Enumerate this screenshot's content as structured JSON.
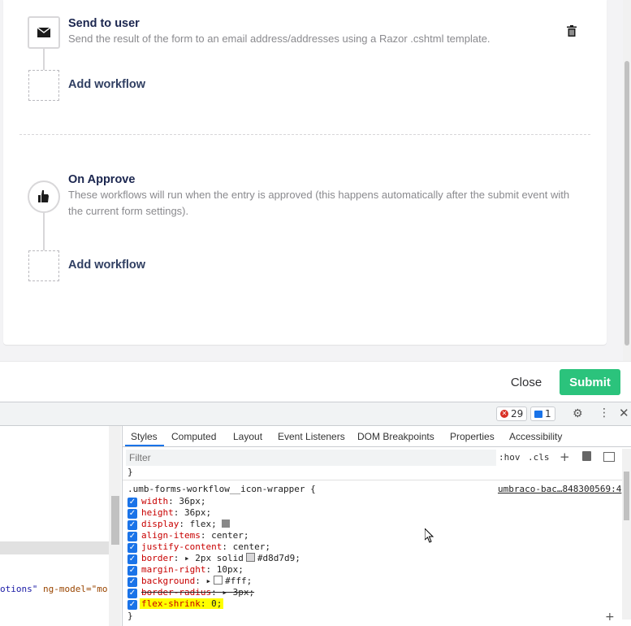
{
  "workflows": {
    "send_to_user": {
      "title": "Send to user",
      "description": "Send the result of the form to an email address/addresses using a Razor .cshtml template."
    },
    "add_workflow_1": "Add workflow",
    "on_approve": {
      "title": "On Approve",
      "description_line1": "These workflows will run when the entry is approved (this happens automatically after the submit event with",
      "description_line2": "the current form settings)."
    },
    "add_workflow_2": "Add workflow"
  },
  "footer": {
    "close_label": "Close",
    "submit_label": "Submit"
  },
  "devtools": {
    "error_count": "29",
    "message_count": "1",
    "tabs": [
      "Styles",
      "Computed",
      "Layout",
      "Event Listeners",
      "DOM Breakpoints",
      "Properties",
      "Accessibility"
    ],
    "filter_placeholder": "Filter",
    "hov": ":hov",
    "cls": ".cls",
    "left_code_frag1": "otions\"",
    "left_code_frag2": "ng-model=\"mo",
    "prev_rule_close": "}",
    "selector": ".umb-forms-workflow__icon-wrapper {",
    "source_link": "umbraco-bac…848300569:4",
    "rules": {
      "width": {
        "name": "width",
        "value": "36px;"
      },
      "height": {
        "name": "height",
        "value": "36px;"
      },
      "display": {
        "name": "display",
        "value": "flex;"
      },
      "align_items": {
        "name": "align-items",
        "value": "center;"
      },
      "justify_content": {
        "name": "justify-content",
        "value": "center;"
      },
      "border": {
        "name": "border",
        "value_pre": "2px solid",
        "value_post": "#d8d7d9;"
      },
      "margin_right": {
        "name": "margin-right",
        "value": "10px;"
      },
      "background": {
        "name": "background",
        "value": "#fff;"
      },
      "border_radius": {
        "name": "border-radius",
        "value": "3px;"
      },
      "flex_shrink": {
        "name": "flex-shrink",
        "value": "0;"
      }
    },
    "rule_close": "}"
  },
  "colors": {
    "submit": "#2bc37c",
    "highlight": "#ffff00",
    "accent": "#1a73e8"
  }
}
